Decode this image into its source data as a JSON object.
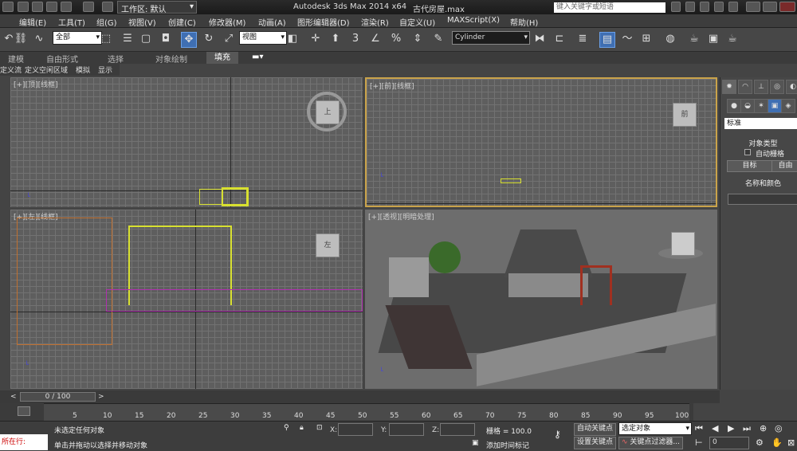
{
  "titlebar": {
    "workspace": "工作区: 默认",
    "app_title": "Autodesk 3ds Max  2014 x64",
    "file_name": "古代房屋.max",
    "search_placeholder": "键入关键字或短语"
  },
  "menu": {
    "items": [
      "编辑(E)",
      "工具(T)",
      "组(G)",
      "视图(V)",
      "创建(C)",
      "修改器(M)",
      "动画(A)",
      "图形编辑器(D)",
      "渲染(R)",
      "自定义(U)",
      "MAXScript(X)",
      "帮助(H)"
    ]
  },
  "toolbar": {
    "selection_filter": "全部",
    "reference_coord": "视图",
    "named_selection": "Cylinder",
    "snap_value": "3"
  },
  "ribbon": {
    "tabs": [
      "建模",
      "自由形式",
      "选择",
      "对象绘制",
      "填充"
    ],
    "active_tab": "填充",
    "subtabs": [
      "定义流",
      "定义空闲区域",
      "模拟",
      "显示"
    ]
  },
  "viewports": {
    "top": {
      "label": "[+][顶][线框]",
      "cube": "上"
    },
    "front": {
      "label": "[+][前][线框]",
      "cube": "前"
    },
    "left": {
      "label": "[+][左][线框]",
      "cube": "左"
    },
    "perspective": {
      "label": "[+][透视][明暗处理]"
    }
  },
  "command_panel": {
    "dropdown": "标准",
    "rollout_object_type": "对象类型",
    "autogrid_label": "自动栅格",
    "btn_target": "目标",
    "btn_free": "自由",
    "rollout_name_color": "名称和颜色"
  },
  "timeline": {
    "frame_display": "0 / 100",
    "ticks": [
      "5",
      "10",
      "15",
      "20",
      "25",
      "30",
      "35",
      "40",
      "45",
      "50",
      "55",
      "60",
      "65",
      "70",
      "75",
      "80",
      "85",
      "90",
      "95",
      "100"
    ]
  },
  "status": {
    "selection": "未选定任何对象",
    "prompt": "单击并拖动以选择并移动对象",
    "current_line": "所在行:",
    "x_label": "X:",
    "y_label": "Y:",
    "z_label": "Z:",
    "grid": "栅格 = 100.0",
    "add_time_tag": "添加时间标记",
    "auto_key": "自动关键点",
    "set_key": "设置关键点",
    "selected_set": "选定对象",
    "key_filters": "关键点过滤器...",
    "frame_value": "0"
  }
}
